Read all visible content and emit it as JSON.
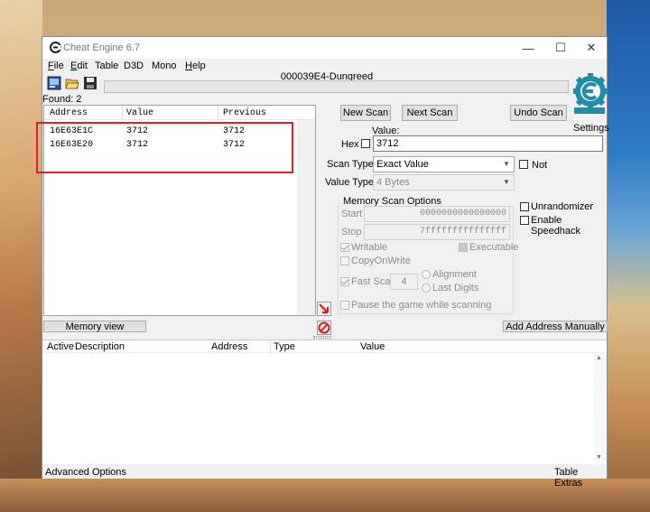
{
  "window": {
    "title": "Cheat Engine 6.7",
    "controls": {
      "minimize": "—",
      "maximize": "☐",
      "close": "✕"
    }
  },
  "menu": [
    {
      "label": "File",
      "underline": "F",
      "rest": "ile"
    },
    {
      "label": "Edit",
      "underline": "E",
      "rest": "dit"
    },
    {
      "label": "Table",
      "underline": "",
      "rest": "Table"
    },
    {
      "label": "D3D",
      "underline": "",
      "rest": "D3D"
    },
    {
      "label": "Mono",
      "underline": "",
      "rest": "Mono"
    },
    {
      "label": "Help",
      "underline": "H",
      "rest": "elp"
    }
  ],
  "process": "000039E4-Dungreed",
  "found": "Found: 2",
  "settings_label": "Settings",
  "results": {
    "columns": [
      "Address",
      "Value",
      "Previous"
    ],
    "rows": [
      {
        "address": "16E63E1C",
        "value": "3712",
        "previous": "3712"
      },
      {
        "address": "16E63E20",
        "value": "3712",
        "previous": "3712"
      }
    ]
  },
  "scan": {
    "new_scan": "New Scan",
    "next_scan": "Next Scan",
    "undo_scan": "Undo Scan",
    "value_label": "Value:",
    "hex_label": "Hex",
    "value": "3712",
    "scan_type_label": "Scan Type",
    "scan_type": "Exact Value",
    "not_label": "Not",
    "value_type_label": "Value Type",
    "value_type": "4 Bytes"
  },
  "memory_options": {
    "title": "Memory Scan Options",
    "start_label": "Start",
    "start": "0000000000000000",
    "stop_label": "Stop",
    "stop": "7fffffffffffffff",
    "writable": "Writable",
    "executable": "Executable",
    "copy_on_write": "CopyOnWrite",
    "fast_scan": "Fast Scan",
    "fast_scan_value": "4",
    "alignment": "Alignment",
    "last_digits": "Last Digits",
    "pause": "Pause the game while scanning"
  },
  "extra_options": {
    "unrandomizer": "Unrandomizer",
    "speedhack": "Enable Speedhack"
  },
  "buttons": {
    "memory_view": "Memory view",
    "add_address": "Add Address Manually"
  },
  "address_list": {
    "columns": [
      "Active",
      "Description",
      "Address",
      "Type",
      "Value"
    ]
  },
  "status": {
    "advanced": "Advanced Options",
    "extras": "Table Extras"
  },
  "colors": {
    "highlight_box": "#e0202a",
    "logo_teal": "#1f8fa8"
  }
}
